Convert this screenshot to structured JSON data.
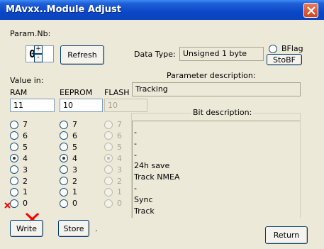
{
  "window": {
    "title": "MAvxx..Module Adjust"
  },
  "param": {
    "label": "Param.Nb:",
    "value": "05",
    "spin_up": "+",
    "spin_down": "-"
  },
  "refresh_label": "Refresh",
  "data_type": {
    "label": "Data Type:",
    "value": "Unsigned 1 byte"
  },
  "bflag": {
    "label": "BFlag"
  },
  "stobf_label": "StoBF",
  "value_in_label": "Value in:",
  "columns": {
    "ram": "RAM",
    "eeprom": "EEPROM",
    "flash": "FLASH"
  },
  "values": {
    "ram": "11",
    "eeprom": "10",
    "flash": "10"
  },
  "param_desc": {
    "label": "Parameter description:",
    "value": "Tracking"
  },
  "bit_desc": {
    "label": "Bit description:",
    "items": [
      "-",
      "-",
      "-",
      "24h save",
      "Track NMEA",
      "-",
      "Sync",
      "Track"
    ]
  },
  "radios": {
    "labels": [
      "7",
      "6",
      "5",
      "4",
      "3",
      "2",
      "1",
      "0"
    ],
    "ram_checked": "4",
    "eeprom_checked": "4",
    "flash_checked": "4"
  },
  "write_label": "Write",
  "store_label": "Store",
  "store_suffix": ".",
  "return_label": "Return",
  "colors": {
    "title_bar": "#0a47c7",
    "close_button": "#d2451d",
    "mark": "#ff0000"
  }
}
